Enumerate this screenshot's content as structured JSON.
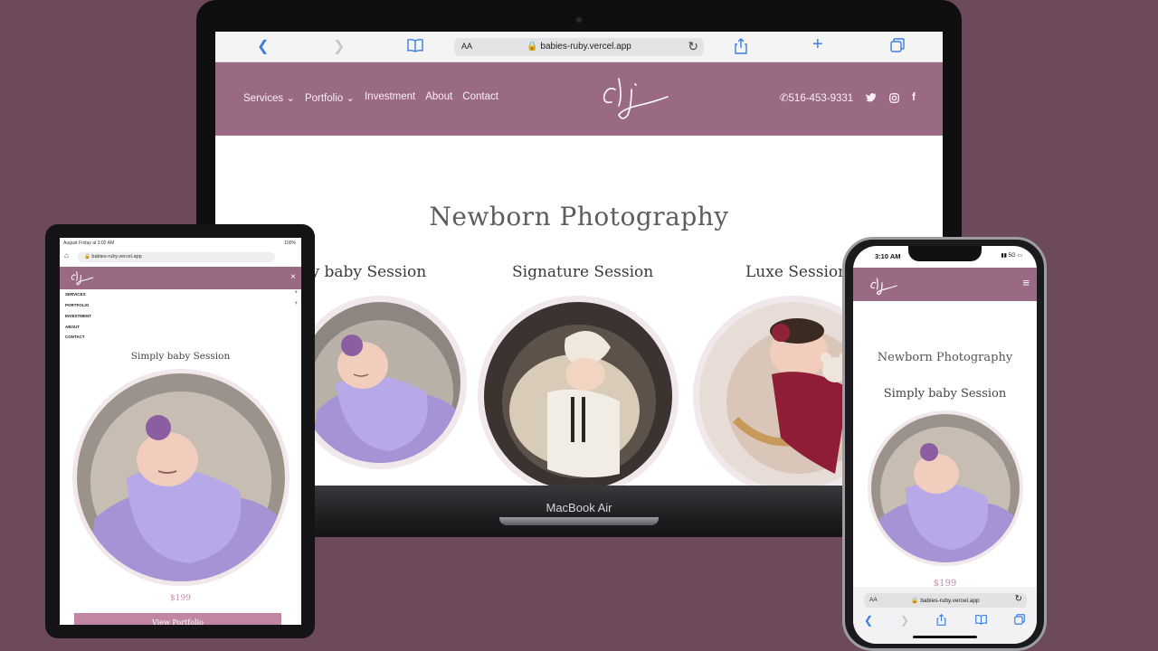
{
  "laptop": {
    "device_label": "MacBook Air",
    "browser": {
      "text_size_label": "AA",
      "url": "babies-ruby.vercel.app",
      "icons": [
        "back-icon",
        "forward-icon",
        "bookmarks-icon",
        "lock-icon",
        "reload-icon",
        "share-icon",
        "new-tab-icon",
        "tabs-icon"
      ]
    },
    "header": {
      "nav": [
        "Services",
        "Portfolio",
        "Investment",
        "About",
        "Contact"
      ],
      "logo_text": "clj",
      "phone": "516-453-9331",
      "social_icons": [
        "twitter-icon",
        "instagram-icon",
        "facebook-icon"
      ]
    },
    "page_title": "Newborn Photography",
    "sessions": [
      "Simply baby Session",
      "Signature Session",
      "Luxe Session"
    ]
  },
  "tablet": {
    "status_left": "August Friday at 3:02 AM",
    "status_right": "100%",
    "url": "babies-ruby.vercel.app",
    "menu": [
      "SERVICES",
      "PORTFOLIO",
      "INVESTMENT",
      "ABOUT",
      "CONTACT"
    ],
    "close": "×",
    "session_title": "Simply baby Session",
    "price": "$199",
    "button": "View Portfolio"
  },
  "phone": {
    "time": "3:10 AM",
    "status": "5G",
    "page_title": "Newborn Photography",
    "session_title": "Simply baby Session",
    "price": "$199",
    "text_size_label": "AA",
    "url": "babies-ruby.vercel.app",
    "menu_icon": "hamburger-icon"
  },
  "colors": {
    "background": "#6c4a5b",
    "brand": "#9a6a85",
    "button": "#c086a3",
    "price": "#c68aa4",
    "link_blue": "#3d7de0"
  }
}
